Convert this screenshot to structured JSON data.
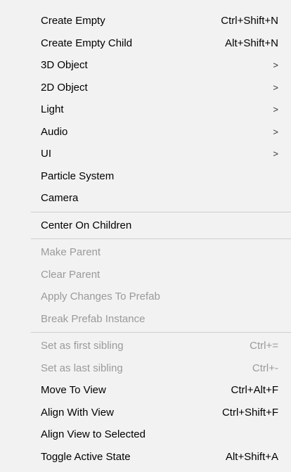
{
  "menu": {
    "group1": [
      {
        "label": "Create Empty",
        "shortcut": "Ctrl+Shift+N",
        "submenu": "",
        "disabled": false
      },
      {
        "label": "Create Empty Child",
        "shortcut": "Alt+Shift+N",
        "submenu": "",
        "disabled": false
      },
      {
        "label": "3D Object",
        "shortcut": "",
        "submenu": ">",
        "disabled": false
      },
      {
        "label": "2D Object",
        "shortcut": "",
        "submenu": ">",
        "disabled": false
      },
      {
        "label": "Light",
        "shortcut": "",
        "submenu": ">",
        "disabled": false
      },
      {
        "label": "Audio",
        "shortcut": "",
        "submenu": ">",
        "disabled": false
      },
      {
        "label": "UI",
        "shortcut": "",
        "submenu": ">",
        "disabled": false
      },
      {
        "label": "Particle System",
        "shortcut": "",
        "submenu": "",
        "disabled": false
      },
      {
        "label": "Camera",
        "shortcut": "",
        "submenu": "",
        "disabled": false
      }
    ],
    "group2": [
      {
        "label": "Center On Children",
        "shortcut": "",
        "submenu": "",
        "disabled": false
      }
    ],
    "group3": [
      {
        "label": "Make Parent",
        "shortcut": "",
        "submenu": "",
        "disabled": true
      },
      {
        "label": "Clear Parent",
        "shortcut": "",
        "submenu": "",
        "disabled": true
      },
      {
        "label": "Apply Changes To Prefab",
        "shortcut": "",
        "submenu": "",
        "disabled": true
      },
      {
        "label": "Break Prefab Instance",
        "shortcut": "",
        "submenu": "",
        "disabled": true
      }
    ],
    "group4": [
      {
        "label": "Set as first sibling",
        "shortcut": "Ctrl+=",
        "submenu": "",
        "disabled": true
      },
      {
        "label": "Set as last sibling",
        "shortcut": "Ctrl+-",
        "submenu": "",
        "disabled": true
      },
      {
        "label": "Move To View",
        "shortcut": "Ctrl+Alt+F",
        "submenu": "",
        "disabled": false
      },
      {
        "label": "Align With View",
        "shortcut": "Ctrl+Shift+F",
        "submenu": "",
        "disabled": false
      },
      {
        "label": "Align View to Selected",
        "shortcut": "",
        "submenu": "",
        "disabled": false
      },
      {
        "label": "Toggle Active State",
        "shortcut": "Alt+Shift+A",
        "submenu": "",
        "disabled": false
      }
    ]
  }
}
